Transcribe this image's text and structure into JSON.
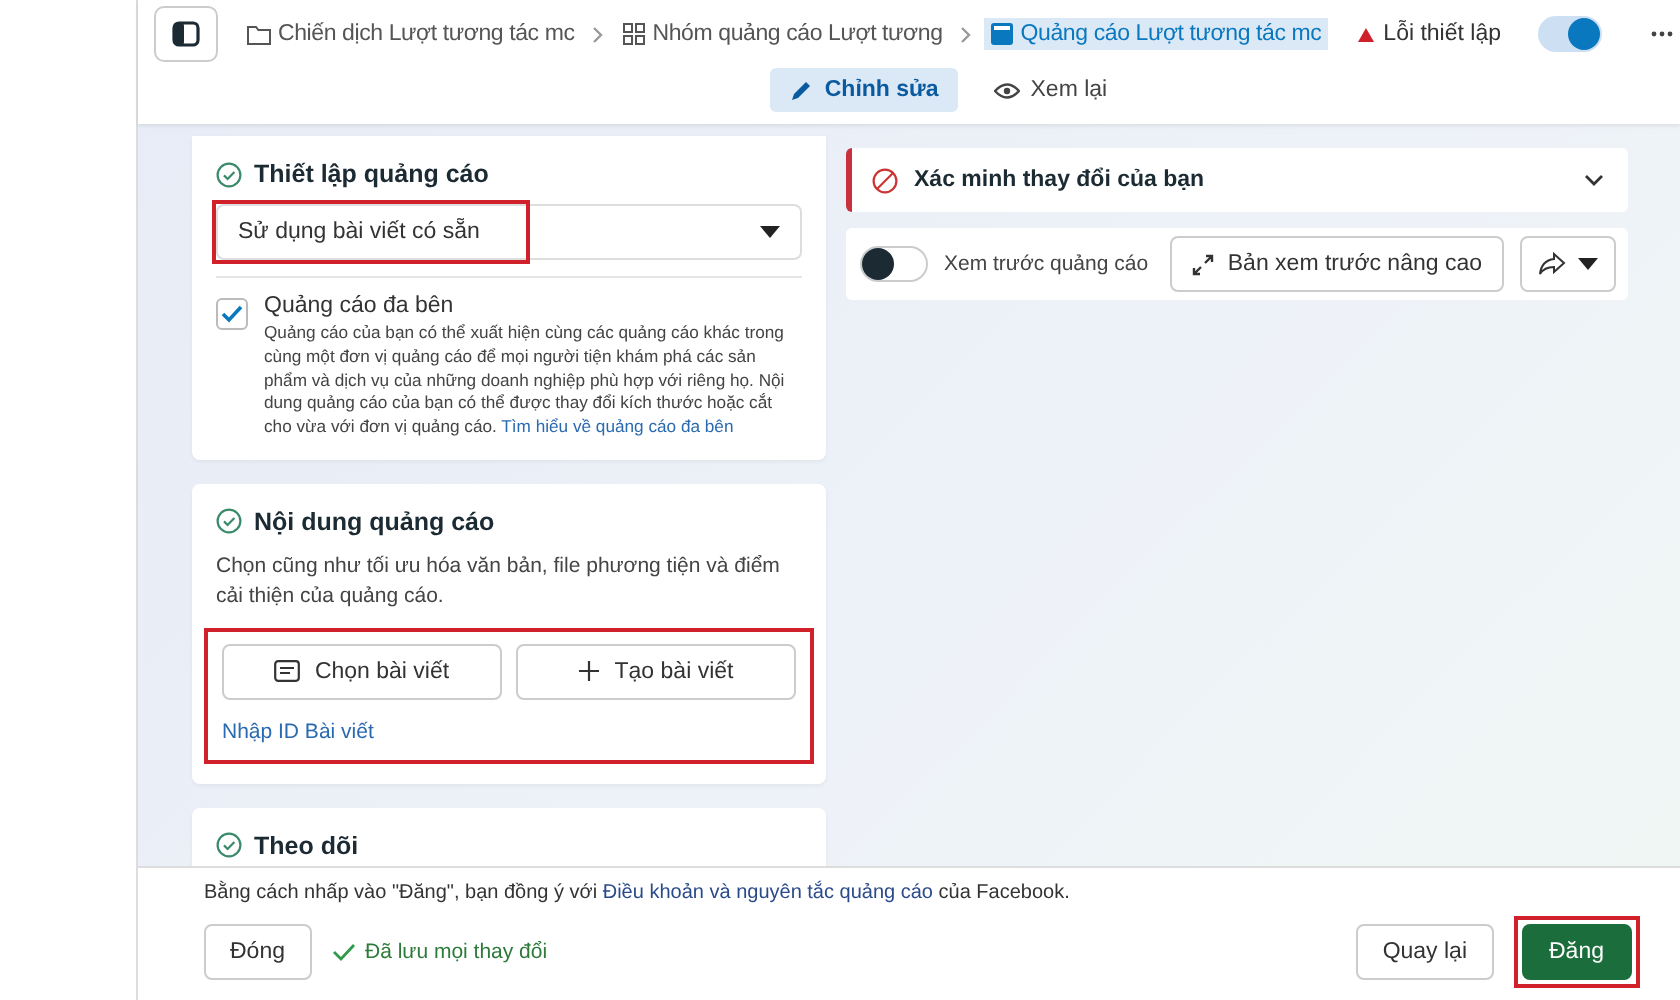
{
  "breadcrumb": [
    {
      "kind": "folder",
      "label": "Chiến dịch Lượt tương tác mc",
      "selected": false
    },
    {
      "kind": "grid",
      "label": "Nhóm quảng cáo Lượt tương",
      "selected": false
    },
    {
      "kind": "ad",
      "label": "Quảng cáo Lượt tương tác mc",
      "selected": true
    }
  ],
  "status": {
    "label": "Lỗi thiết lập"
  },
  "ad_toggle": {
    "on": true
  },
  "view_tabs": [
    {
      "kind": "edit",
      "label": "Chỉnh sửa",
      "selected": true
    },
    {
      "kind": "review",
      "label": "Xem lại",
      "selected": false
    }
  ],
  "ad_setup": {
    "title": "Thiết lập quảng cáo",
    "select": {
      "value": "Sử dụng bài viết có sẵn",
      "highlighted": true
    },
    "carousel": {
      "label": "Quảng cáo đa bên",
      "checked": true,
      "description": "Quảng cáo của bạn có thể xuất hiện cùng các quảng cáo khác trong cùng một đơn vị quảng cáo để mọi người tiện khám phá các sản phẩm và dịch vụ của những doanh nghiệp phù hợp với riêng họ. Nội dung quảng cáo của bạn có thể được thay đổi kích thước hoặc cắt cho vừa với đơn vị quảng cáo.",
      "link": "Tìm hiểu về quảng cáo đa bên"
    }
  },
  "ad_content": {
    "title": "Nội dung quảng cáo",
    "description": "Chọn cũng như tối ưu hóa văn bản, file phương tiện và điểm cải thiện của quảng cáo.",
    "highlighted": true,
    "buttons": [
      {
        "kind": "choose",
        "label": "Chọn bài viết"
      },
      {
        "kind": "create",
        "label": "Tạo bài viết"
      }
    ],
    "link": "Nhập ID Bài viết"
  },
  "tracking": {
    "title": "Theo dõi"
  },
  "verify": {
    "title": "Xác minh thay đổi của bạn"
  },
  "preview": {
    "toggle": {
      "label": "Xem trước quảng cáo",
      "on": false
    },
    "advanced": "Bản xem trước nâng cao"
  },
  "footer": {
    "terms_before": "Bằng cách nhấp vào \"Đăng\", bạn đồng ý với ",
    "terms_link": "Điều khoản và nguyên tắc quảng cáo",
    "terms_after": " của Facebook.",
    "close": "Đóng",
    "saved": "Đã lưu mọi thay đổi",
    "back": "Quay lại",
    "publish": {
      "label": "Đăng",
      "highlighted": true
    }
  }
}
